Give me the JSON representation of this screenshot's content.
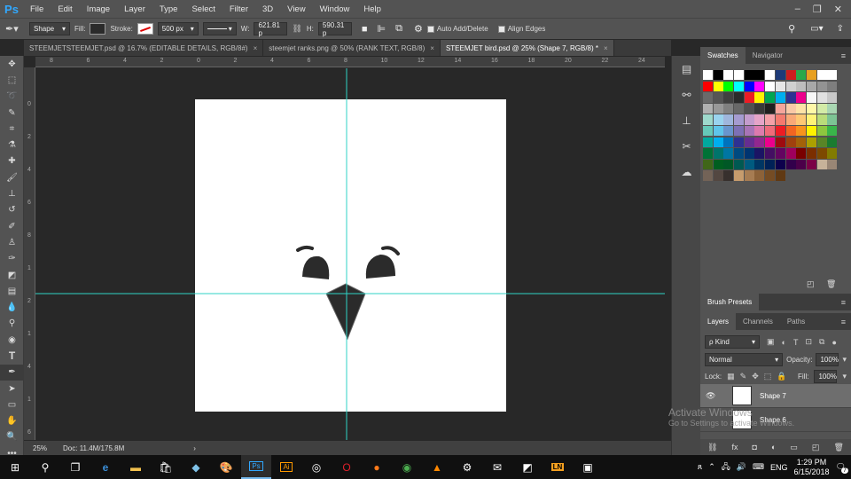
{
  "app": {
    "logo": "Ps",
    "name": "Photoshop"
  },
  "menu": [
    "File",
    "Edit",
    "Image",
    "Layer",
    "Type",
    "Select",
    "Filter",
    "3D",
    "View",
    "Window",
    "Help"
  ],
  "window_controls": {
    "minimize": "–",
    "restore": "❐",
    "close": "✕"
  },
  "options_bar": {
    "mode": "Shape",
    "fill_label": "Fill:",
    "stroke_label": "Stroke:",
    "stroke_size": "500 px",
    "w_label": "W:",
    "w_value": "621.81 p",
    "link_icon": "link-icon",
    "h_label": "H:",
    "h_value": "590.31 p",
    "auto_add_delete": "Auto Add/Delete",
    "align_edges": "Align Edges"
  },
  "tabs": [
    {
      "label": "STEEMJETSTEEMJET.psd @ 16.7% (EDITABLE DETAILS, RGB/8#)"
    },
    {
      "label": "steemjet ranks.png @ 50% (RANK TEXT, RGB/8)"
    },
    {
      "label": "STEEMJET bird.psd @ 25% (Shape 7, RGB/8) *"
    }
  ],
  "ruler_top": [
    "8",
    "6",
    "4",
    "2",
    "0",
    "2",
    "4",
    "6",
    "8",
    "10",
    "12",
    "14",
    "16",
    "18",
    "20",
    "22",
    "24"
  ],
  "ruler_left": [
    "0",
    "2",
    "4",
    "6",
    "8",
    "1",
    "2",
    "1",
    "4",
    "1",
    "6"
  ],
  "status": {
    "zoom": "25%",
    "doc": "Doc: 11.4M/175.8M"
  },
  "colors": {
    "guide": "#2fd3c6",
    "bird": "#2b2b2b",
    "canvas": "#ffffff"
  },
  "panels": {
    "swatches_tab": "Swatches",
    "navigator_tab": "Navigator",
    "brush_presets": "Brush Presets",
    "layers_tab": "Layers",
    "channels_tab": "Channels",
    "paths_tab": "Paths",
    "kind_label": "ρ Kind",
    "blend_mode": "Normal",
    "opacity_label": "Opacity:",
    "opacity_value": "100%",
    "lock_label": "Lock:",
    "fill_label": "Fill:",
    "fill_value": "100%",
    "layers": [
      {
        "name": "Shape 7",
        "selected": true
      },
      {
        "name": "Shape 6",
        "selected": false
      }
    ]
  },
  "swatch_colors": [
    "#ffffff",
    "#000000",
    "#ffffff",
    "#ffffff",
    "#000000",
    "#000000",
    "#ffffff",
    "#1e3a78",
    "#cc1e1e",
    "#2aa84a",
    "#e8a020",
    "#ffffff",
    "#ffffff",
    "#ff0000",
    "#ffff00",
    "#00ff00",
    "#00ffff",
    "#0000ff",
    "#ff00ff",
    "#ffffff",
    "#e6e6e6",
    "#d0d0d0",
    "#bdbdbd",
    "#a8a8a8",
    "#939393",
    "#7e7e7e",
    "#6a6a6a",
    "#555555",
    "#404040",
    "#2b2b2b",
    "#ed1c24",
    "#fff200",
    "#00a651",
    "#00aeef",
    "#2e3192",
    "#ec008c",
    "#f7f7f7",
    "#e0e0e0",
    "#c8c8c8",
    "#b0b0b0",
    "#989898",
    "#808080",
    "#686868",
    "#505050",
    "#383838",
    "#202020",
    "#f4a59b",
    "#f9c9a6",
    "#fde3a7",
    "#fff8a8",
    "#d3eba7",
    "#a9d6b2",
    "#9ed9cc",
    "#9ad3ee",
    "#9fb6dd",
    "#a59bd0",
    "#c49ccd",
    "#e6a4c8",
    "#f4a0a8",
    "#f37a6e",
    "#f8a977",
    "#fdc874",
    "#fff377",
    "#b9dc7a",
    "#7dc494",
    "#66c9b8",
    "#5fc4e9",
    "#6995cd",
    "#7d70b5",
    "#a874b6",
    "#dd7aad",
    "#ef6b7a",
    "#ed1c24",
    "#f26522",
    "#f7941d",
    "#fff200",
    "#8dc63f",
    "#39b54a",
    "#00a99d",
    "#00aeef",
    "#0072bc",
    "#2e3192",
    "#662d91",
    "#92278f",
    "#ec008c",
    "#9e0b0f",
    "#a0410d",
    "#a36209",
    "#aba000",
    "#598527",
    "#1a7b30",
    "#007236",
    "#00746b",
    "#0076a3",
    "#004a80",
    "#003471",
    "#1b1464",
    "#440e62",
    "#630460",
    "#9e005d",
    "#790000",
    "#7b2e00",
    "#7d4900",
    "#827b00",
    "#406618",
    "#005e20",
    "#005826",
    "#005952",
    "#005b7f",
    "#003663",
    "#002157",
    "#0d004c",
    "#32004b",
    "#4b0049",
    "#7b0046",
    "#c7b299",
    "#998675",
    "#736357",
    "#534741",
    "#37302d",
    "#c69c6d",
    "#a67c52",
    "#8c6239",
    "#754c24",
    "#603913"
  ],
  "taskbar": {
    "icons": [
      "windows-icon",
      "search-icon",
      "task-view-icon",
      "edge-icon",
      "explorer-icon",
      "store-icon",
      "app-icon",
      "paint-icon",
      "photoshop-icon",
      "illustrator-icon",
      "obs-icon",
      "opera-icon",
      "firefox-icon",
      "chrome-icon",
      "vlc-icon",
      "settings-icon",
      "mail-icon",
      "notes-icon",
      "ln-icon",
      "media-icon"
    ],
    "ps_label": "Ps",
    "ai_label": "Ai",
    "ln_label": "LN",
    "lang": "ENG",
    "time": "1:29 PM",
    "date": "6/15/2018",
    "notif": "7"
  },
  "watermark": {
    "title": "Activate Windows",
    "subtitle": "Go to Settings to activate Windows."
  }
}
